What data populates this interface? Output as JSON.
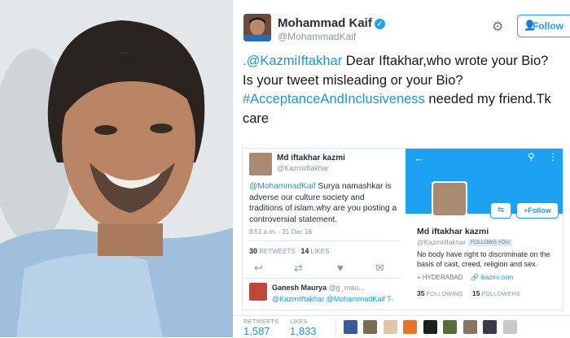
{
  "author": {
    "name": "Mohammad Kaif",
    "handle": "@MohammadKaif",
    "follow_label": "Follow"
  },
  "tweet": {
    "mention": ".@KazmiIftakhar",
    "line1": " Dear Iftakhar,who wrote your Bio?",
    "line2": "Is your tweet misleading or your Bio?",
    "hashtag": "#AcceptanceAndInclusiveness",
    "line3": " needed my friend.Tk care"
  },
  "quoted_tweet": {
    "name": "Md iftakhar kazmi",
    "handle": "@Kazmiiftakhar",
    "mention": "@MohammadKaif",
    "body": " Surya namashkar is adverse our culture society and traditions of islam.why are you posting a controversial statement.",
    "timestamp": "8:51 a.m. - 31 Dec 16",
    "retweets_count": "30",
    "retweets_label": "RETWEETS",
    "likes_count": "14",
    "likes_label": "LIKES",
    "reply_name": "Ganesh Maurya",
    "reply_handle": "@g_mau...",
    "reply_text": "@KazmiIftakhar @MohammadKaif T-"
  },
  "profile_card": {
    "name": "Md iftakhar kazmi",
    "handle": "@Kazmiiftakhar",
    "follows_you": "FOLLOWS YOU",
    "follow_label": "Follow",
    "bio": "No body have right to discriminate on the basis of cast, creed, religion and sex.",
    "location": "HYDERABAD",
    "url": "ikazmi.com",
    "following_count": "35",
    "following_label": "FOLLOWING",
    "followers_count": "15",
    "followers_label": "FOLLOWERS"
  },
  "stats": {
    "retweets_label": "RETWEETS",
    "retweets": "1,587",
    "likes_label": "LIKES",
    "likes": "1,833"
  },
  "colors": {
    "accent": "#1da1f2",
    "link": "#1b95e0",
    "text": "#14171a"
  }
}
